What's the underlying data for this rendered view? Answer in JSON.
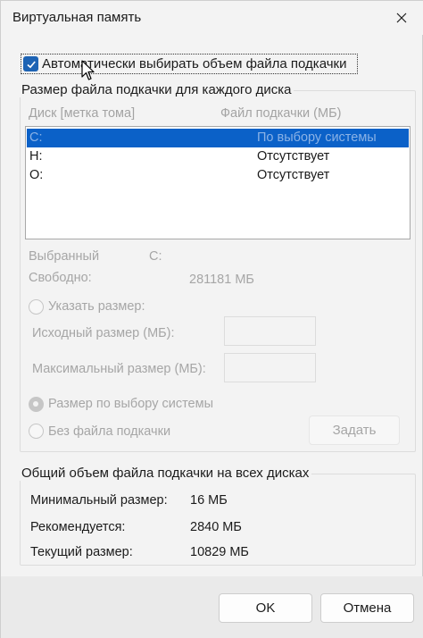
{
  "window": {
    "title": "Виртуальная память"
  },
  "auto_checkbox": {
    "label": "Автоматически выбирать объем файла подкачки",
    "checked": true
  },
  "per_disk": {
    "group_title": "Размер файла подкачки для каждого диска",
    "columns": {
      "drive": "Диск [метка тома]",
      "size": "Файл подкачки (МБ)"
    },
    "rows": [
      {
        "drive": "C:",
        "size": "По выбору системы",
        "selected": true
      },
      {
        "drive": "H:",
        "size": "Отсутствует",
        "selected": false
      },
      {
        "drive": "O:",
        "size": "Отсутствует",
        "selected": false
      }
    ],
    "selected_label": "Выбранный",
    "selected_value": "C:",
    "free_label": "Свободно:",
    "free_value": "281181 МБ",
    "custom_size_label": "Указать размер:",
    "initial_label": "Исходный размер (МБ):",
    "initial_value": "",
    "max_label": "Максимальный размер (МБ):",
    "max_value": "",
    "system_managed_label": "Размер по выбору системы",
    "no_file_label": "Без файла подкачки",
    "set_button": "Задать",
    "selected_option": "system_managed"
  },
  "total": {
    "group_title": "Общий объем файла подкачки на всех дисках",
    "min_label": "Минимальный размер:",
    "min_value": "16 МБ",
    "recommended_label": "Рекомендуется:",
    "recommended_value": "2840 МБ",
    "current_label": "Текущий размер:",
    "current_value": "10829 МБ"
  },
  "buttons": {
    "ok": "OK",
    "cancel": "Отмена"
  },
  "colors": {
    "accent": "#1d63b4",
    "selection": "#0b61c8",
    "disabled_text": "#a6a6a6"
  },
  "icons": {
    "close": "close-icon",
    "check": "checkmark-icon",
    "cursor": "mouse-pointer-icon"
  }
}
